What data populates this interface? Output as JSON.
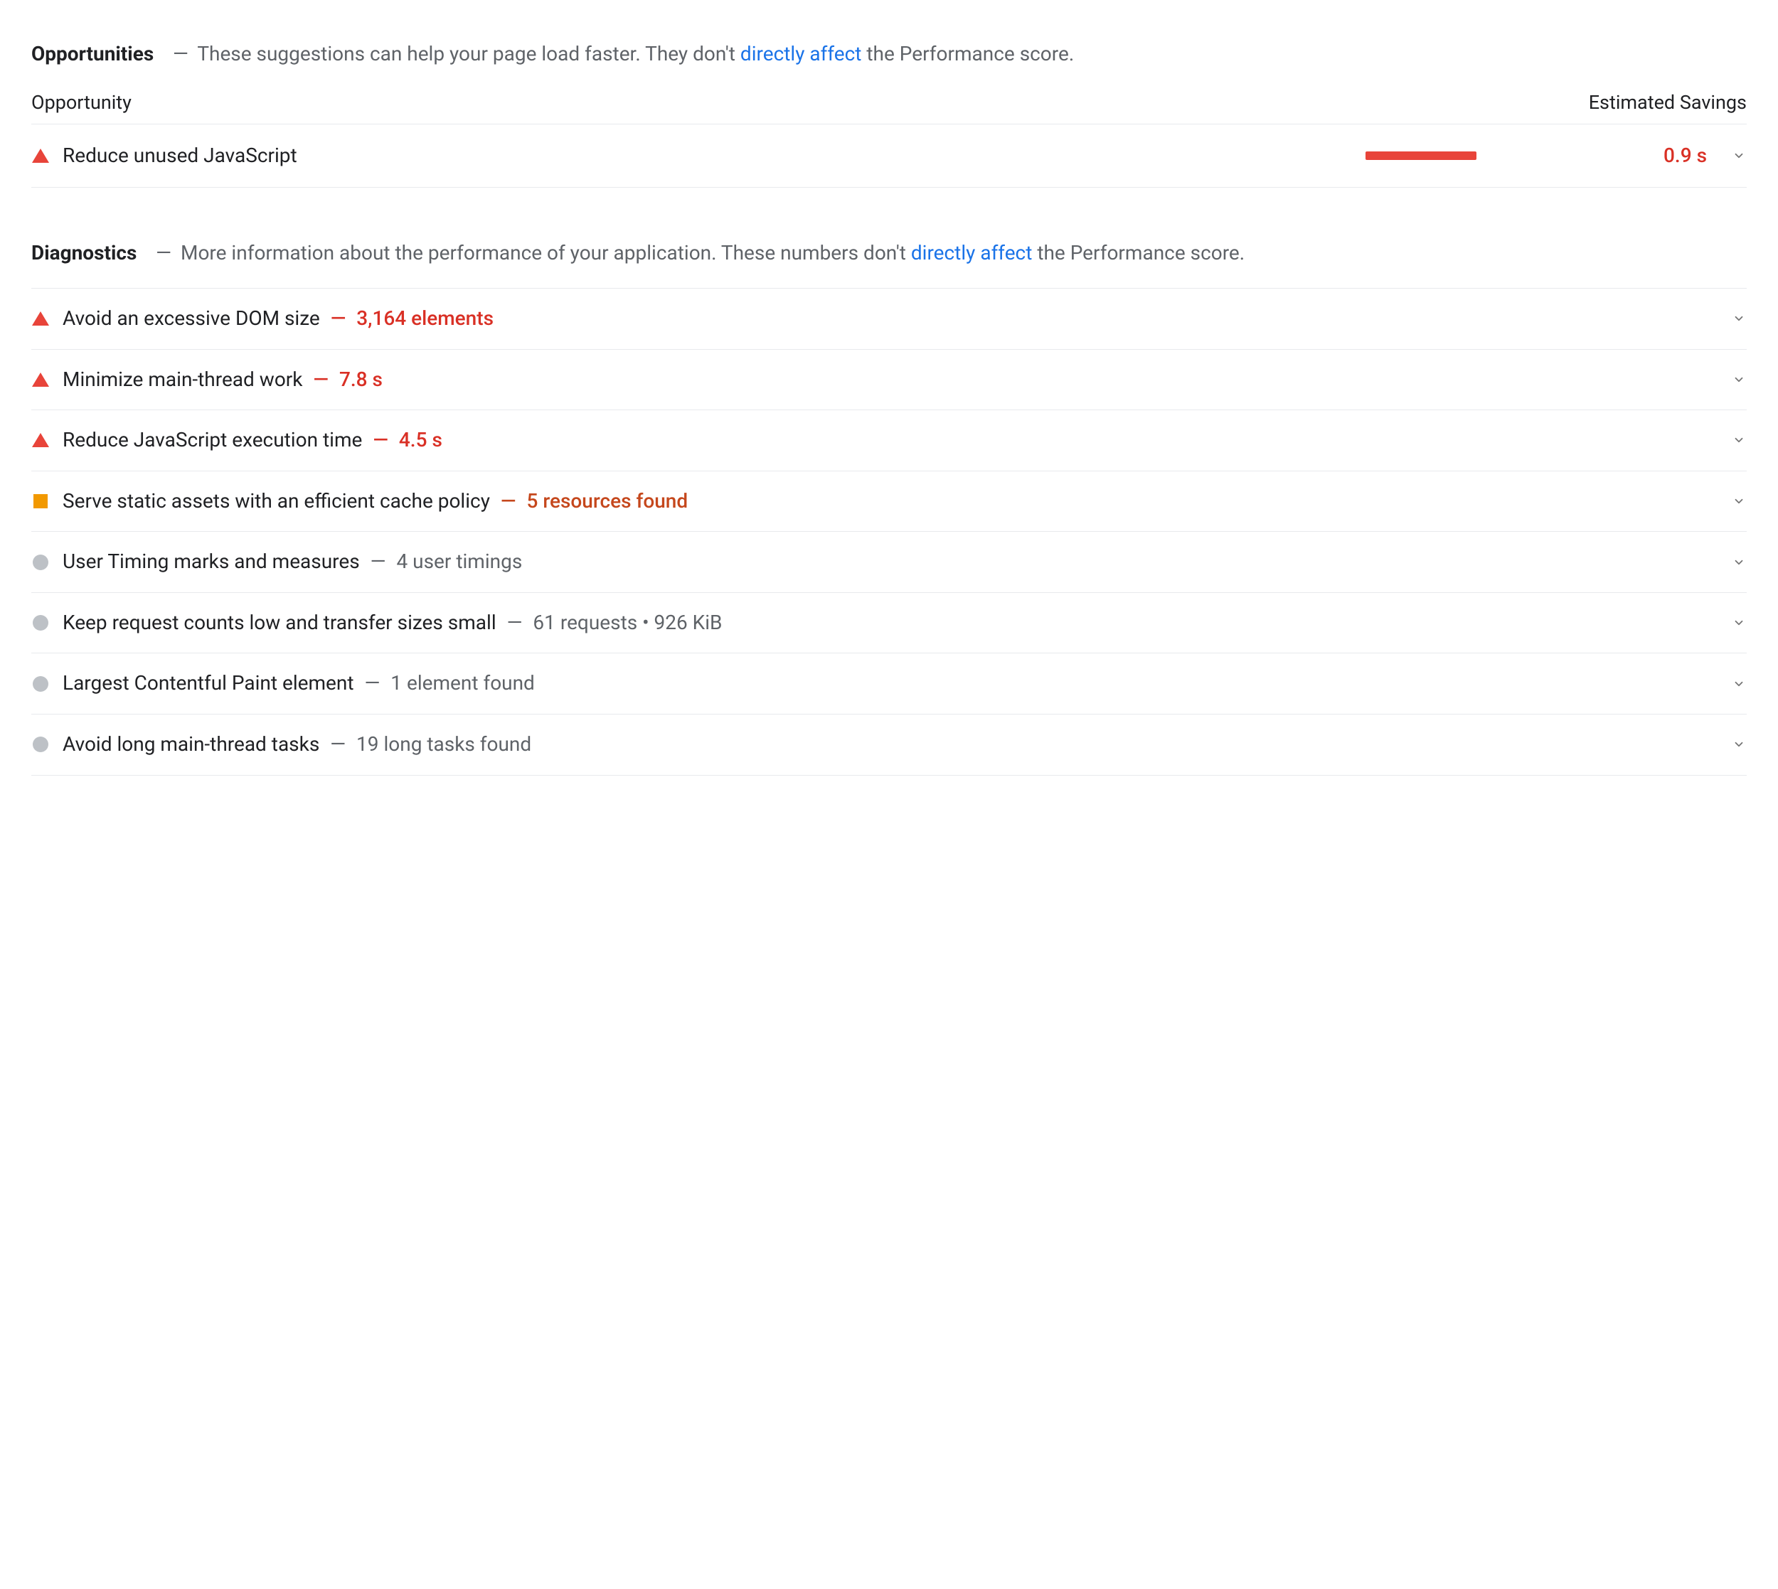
{
  "colors": {
    "link": "#1a73e8",
    "red": "#e8443a",
    "red_text": "#d93025",
    "orange": "#c5471c",
    "amber": "#f29900",
    "grey_dot": "#bdc1c6",
    "muted": "#5f6368"
  },
  "opportunities": {
    "title": "Opportunities",
    "dash": "—",
    "description_before": "These suggestions can help your page load faster. They don't ",
    "description_link": "directly affect",
    "description_after": " the Performance score.",
    "col_opportunity": "Opportunity",
    "col_savings": "Estimated Savings",
    "items": [
      {
        "severity_icon": "triangle-red",
        "label": "Reduce unused JavaScript",
        "bar_fraction": 0.46,
        "savings": "0.9 s"
      }
    ]
  },
  "diagnostics": {
    "title": "Diagnostics",
    "dash": "—",
    "description_before": "More information about the performance of your application. These numbers don't ",
    "description_link": "directly affect",
    "description_after": " the Performance score.",
    "items": [
      {
        "severity_icon": "triangle-red",
        "label": "Avoid an excessive DOM size",
        "sep": "—",
        "value": "3,164 elements",
        "value_style": "red"
      },
      {
        "severity_icon": "triangle-red",
        "label": "Minimize main-thread work",
        "sep": "—",
        "value": "7.8 s",
        "value_style": "red"
      },
      {
        "severity_icon": "triangle-red",
        "label": "Reduce JavaScript execution time",
        "sep": "—",
        "value": "4.5 s",
        "value_style": "red"
      },
      {
        "severity_icon": "square-amber",
        "label": "Serve static assets with an efficient cache policy",
        "sep": "—",
        "value": "5 resources found",
        "value_style": "orange"
      },
      {
        "severity_icon": "circle-grey",
        "label": "User Timing marks and measures",
        "sep": "—",
        "value": "4 user timings",
        "value_style": "grey"
      },
      {
        "severity_icon": "circle-grey",
        "label": "Keep request counts low and transfer sizes small",
        "sep": "—",
        "value": "61 requests • 926 KiB",
        "value_style": "grey"
      },
      {
        "severity_icon": "circle-grey",
        "label": "Largest Contentful Paint element",
        "sep": "—",
        "value": "1 element found",
        "value_style": "grey"
      },
      {
        "severity_icon": "circle-grey",
        "label": "Avoid long main-thread tasks",
        "sep": "—",
        "value": "19 long tasks found",
        "value_style": "grey"
      }
    ]
  }
}
